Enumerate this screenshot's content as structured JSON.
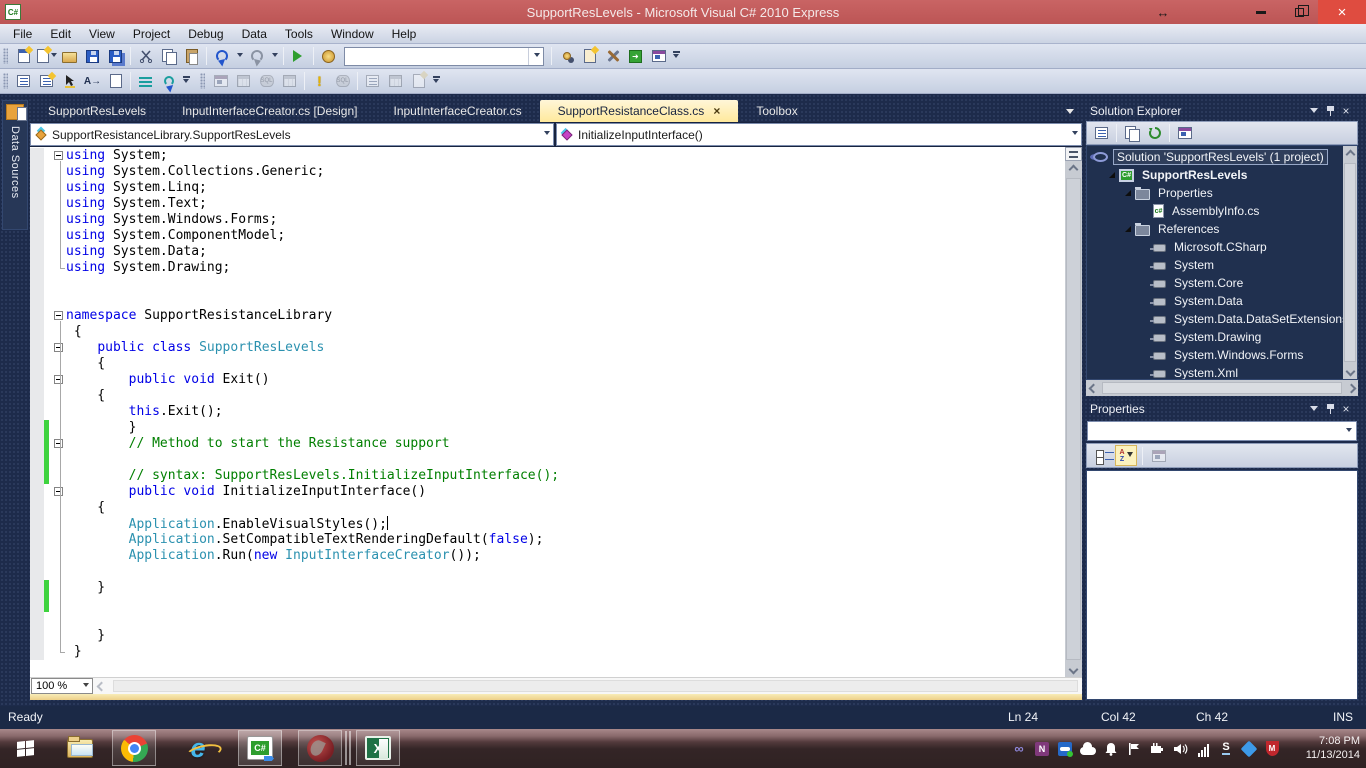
{
  "window": {
    "app_icon": "C#",
    "title": "SupportResLevels - Microsoft Visual C# 2010 Express"
  },
  "menubar": {
    "items": [
      "File",
      "Edit",
      "View",
      "Project",
      "Debug",
      "Data",
      "Tools",
      "Window",
      "Help"
    ]
  },
  "toolbars": {
    "search_value": ""
  },
  "left_dock": {
    "tab": "Data Sources"
  },
  "editor": {
    "tabs": [
      {
        "label": "SupportResLevels"
      },
      {
        "label": "InputInterfaceCreator.cs [Design]"
      },
      {
        "label": "InputInterfaceCreator.cs"
      },
      {
        "label": "SupportResistanceClass.cs",
        "active": true,
        "closable": true
      },
      {
        "label": "Toolbox"
      }
    ],
    "navbar": {
      "type_dropdown": "SupportResistanceLibrary.SupportResLevels",
      "member_dropdown": "InitializeInputInterface()"
    },
    "zoom_level": "100 %",
    "code": {
      "lines": [
        {
          "s": [
            [
              "k",
              "using"
            ],
            [
              "p",
              " System;"
            ]
          ],
          "b": true
        },
        {
          "s": [
            [
              "k",
              "using"
            ],
            [
              "p",
              " System.Collections.Generic;"
            ]
          ]
        },
        {
          "s": [
            [
              "k",
              "using"
            ],
            [
              "p",
              " System.Linq;"
            ]
          ]
        },
        {
          "s": [
            [
              "k",
              "using"
            ],
            [
              "p",
              " System.Text;"
            ]
          ]
        },
        {
          "s": [
            [
              "k",
              "using"
            ],
            [
              "p",
              " System.Windows.Forms;"
            ]
          ]
        },
        {
          "s": [
            [
              "k",
              "using"
            ],
            [
              "p",
              " System.ComponentModel;"
            ]
          ]
        },
        {
          "s": [
            [
              "k",
              "using"
            ],
            [
              "p",
              " System.Data;"
            ]
          ]
        },
        {
          "s": [
            [
              "k",
              "using"
            ],
            [
              "p",
              " System.Drawing;"
            ]
          ]
        },
        {
          "s": []
        },
        {
          "s": []
        },
        {
          "s": [
            [
              "k",
              "namespace"
            ],
            [
              "p",
              " SupportResistanceLibrary"
            ]
          ],
          "b": true
        },
        {
          "s": [
            [
              "p",
              " {"
            ]
          ]
        },
        {
          "s": [
            [
              "p",
              "    "
            ],
            [
              "k",
              "public"
            ],
            [
              "p",
              " "
            ],
            [
              "k",
              "class"
            ],
            [
              "p",
              " "
            ],
            [
              "t",
              "SupportResLevels"
            ]
          ],
          "b": true
        },
        {
          "s": [
            [
              "p",
              "    {"
            ]
          ]
        },
        {
          "s": [
            [
              "p",
              "        "
            ],
            [
              "k",
              "public"
            ],
            [
              "p",
              " "
            ],
            [
              "k",
              "void"
            ],
            [
              "p",
              " Exit()"
            ]
          ],
          "b": true
        },
        {
          "s": [
            [
              "p",
              "    {"
            ]
          ]
        },
        {
          "s": [
            [
              "p",
              "        "
            ],
            [
              "k",
              "this"
            ],
            [
              "p",
              ".Exit();"
            ]
          ]
        },
        {
          "s": [
            [
              "p",
              "        }"
            ]
          ],
          "g": true
        },
        {
          "s": [
            [
              "p",
              "        "
            ],
            [
              "c",
              "// Method to start the Resistance support"
            ]
          ],
          "b": true,
          "g": true
        },
        {
          "s": [],
          "g": true
        },
        {
          "s": [
            [
              "p",
              "        "
            ],
            [
              "c",
              "// syntax: SupportResLevels.InitializeInputInterface();"
            ]
          ],
          "g": true
        },
        {
          "s": [
            [
              "p",
              "        "
            ],
            [
              "k",
              "public"
            ],
            [
              "p",
              " "
            ],
            [
              "k",
              "void"
            ],
            [
              "p",
              " InitializeInputInterface()"
            ]
          ],
          "b": true
        },
        {
          "s": [
            [
              "p",
              "    {"
            ]
          ]
        },
        {
          "s": [
            [
              "p",
              "        "
            ],
            [
              "t",
              "Application"
            ],
            [
              "p",
              ".EnableVisualStyles();"
            ]
          ],
          "caret": true
        },
        {
          "s": [
            [
              "p",
              "        "
            ],
            [
              "t",
              "Application"
            ],
            [
              "p",
              ".SetCompatibleTextRenderingDefault("
            ],
            [
              "k",
              "false"
            ],
            [
              "p",
              ");"
            ]
          ]
        },
        {
          "s": [
            [
              "p",
              "        "
            ],
            [
              "t",
              "Application"
            ],
            [
              "p",
              ".Run("
            ],
            [
              "k",
              "new"
            ],
            [
              "p",
              " "
            ],
            [
              "t",
              "InputInterfaceCreator"
            ],
            [
              "p",
              "());"
            ]
          ]
        },
        {
          "s": []
        },
        {
          "s": [
            [
              "p",
              "    }"
            ]
          ],
          "g": true
        },
        {
          "s": [],
          "g": true
        },
        {
          "s": []
        },
        {
          "s": [
            [
              "p",
              "    }"
            ]
          ]
        },
        {
          "s": [
            [
              "p",
              " }"
            ]
          ]
        }
      ],
      "outline_spans": [
        {
          "from": 1,
          "to": 8
        },
        {
          "from": 11,
          "to": 32
        }
      ]
    }
  },
  "solution_explorer": {
    "title": "Solution Explorer",
    "tree": [
      {
        "label": "Solution 'SupportResLevels' (1 project)",
        "icon": "solution",
        "level": 0,
        "selected": true
      },
      {
        "label": "SupportResLevels",
        "icon": "project",
        "level": 1,
        "bold": true,
        "expanded": true
      },
      {
        "label": "Properties",
        "icon": "folder",
        "level": 2,
        "expanded": true
      },
      {
        "label": "AssemblyInfo.cs",
        "icon": "csfile",
        "level": 3
      },
      {
        "label": "References",
        "icon": "folder",
        "level": 2,
        "expanded": true
      },
      {
        "label": "Microsoft.CSharp",
        "icon": "reference",
        "level": 3
      },
      {
        "label": "System",
        "icon": "reference",
        "level": 3
      },
      {
        "label": "System.Core",
        "icon": "reference",
        "level": 3
      },
      {
        "label": "System.Data",
        "icon": "reference",
        "level": 3
      },
      {
        "label": "System.Data.DataSetExtensions",
        "icon": "reference",
        "level": 3
      },
      {
        "label": "System.Drawing",
        "icon": "reference",
        "level": 3
      },
      {
        "label": "System.Windows.Forms",
        "icon": "reference",
        "level": 3
      },
      {
        "label": "System.Xml",
        "icon": "reference",
        "level": 3
      }
    ]
  },
  "properties_panel": {
    "title": "Properties",
    "selector_value": ""
  },
  "status_bar": {
    "message": "Ready",
    "fields": [
      "Ln 24",
      "Col 42",
      "Ch 42",
      "INS"
    ]
  },
  "taskbar": {
    "apps": [
      "start",
      "file-explorer",
      "chrome",
      "internet-explorer",
      "visual-csharp",
      "trading-app",
      "excel"
    ],
    "tray_icons": [
      "visual-studio",
      "onenote",
      "teamviewer",
      "skydrive-cloud",
      "notification-bell",
      "action-center-flag",
      "power-battery",
      "volume",
      "network-signal",
      "synaptics",
      "dropbox",
      "mcafee"
    ],
    "clock": {
      "time": "7:08 PM",
      "date": "11/13/2014"
    }
  },
  "colors": {
    "titlebar": "#C25B5B",
    "close_button": "#DF4C40",
    "chrome_dark": "#1D2B4B",
    "active_tab": "#FFE99C",
    "keyword": "#0000E6",
    "type_name": "#2B91AF",
    "comment": "#007F00",
    "change_bar": "#3ED33E",
    "status_bar": "#1B2946"
  }
}
